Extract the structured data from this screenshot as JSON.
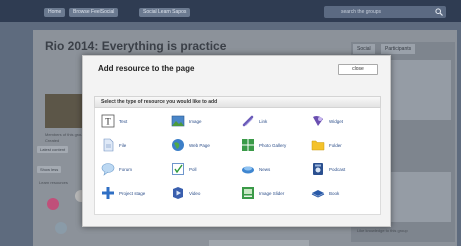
{
  "topbar": {
    "nav_items": [
      "Home",
      "Browse FeelSocial",
      "Social Learn Sapos"
    ],
    "search_placeholder": "search the groups"
  },
  "page": {
    "title": "Rio 2014: Everything is practice",
    "caption_lines": [
      "Members of this group",
      "Created"
    ],
    "chip_label": "Latest content",
    "section_label": "Show less",
    "side_text": "Learn resources",
    "right_tabs": [
      "Social",
      "Participants"
    ],
    "right_bottom_text": "Like knowledge to this group"
  },
  "modal": {
    "title": "Add resource to the page",
    "close_label": "close",
    "select_label": "Select the type of resource you would like to add",
    "resources": [
      {
        "label": "Text",
        "icon": "text-icon"
      },
      {
        "label": "Image",
        "icon": "image-icon"
      },
      {
        "label": "Link",
        "icon": "link-icon"
      },
      {
        "label": "Widget",
        "icon": "widget-icon"
      },
      {
        "label": "File",
        "icon": "file-icon"
      },
      {
        "label": "Web Page",
        "icon": "web-page-icon"
      },
      {
        "label": "Photo Gallery",
        "icon": "photo-gallery-icon"
      },
      {
        "label": "Folder",
        "icon": "folder-icon"
      },
      {
        "label": "Forum",
        "icon": "forum-icon"
      },
      {
        "label": "Poll",
        "icon": "poll-icon"
      },
      {
        "label": "News",
        "icon": "news-icon"
      },
      {
        "label": "Podcast",
        "icon": "podcast-icon"
      },
      {
        "label": "Project stage",
        "icon": "project-stage-icon"
      },
      {
        "label": "Video",
        "icon": "video-icon"
      },
      {
        "label": "Image Slider",
        "icon": "image-slider-icon"
      },
      {
        "label": "Book",
        "icon": "book-icon"
      }
    ]
  },
  "colors": {
    "overlay_bg": "#5e6b7e",
    "topbar": "#2f3c52",
    "modal_bg": "#f3f3f3",
    "link_blue": "#2d4f8a"
  }
}
